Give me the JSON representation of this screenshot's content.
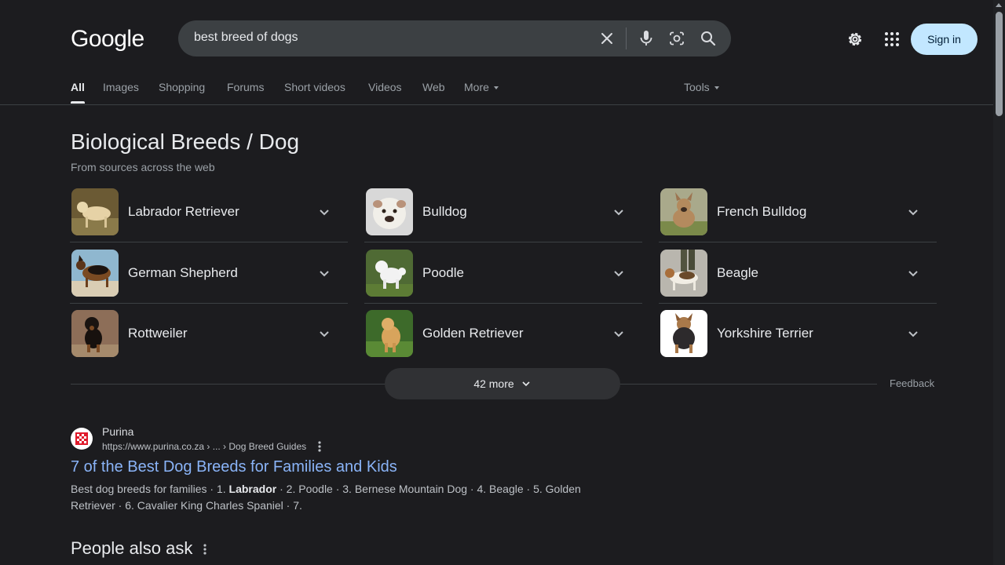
{
  "header": {
    "logo": "Google",
    "query": "best breed of dogs",
    "sign_in": "Sign in"
  },
  "tabs": [
    {
      "label": "All"
    },
    {
      "label": "Images"
    },
    {
      "label": "Shopping"
    },
    {
      "label": "Forums"
    },
    {
      "label": "Short videos"
    },
    {
      "label": "Videos"
    },
    {
      "label": "Web"
    },
    {
      "label": "More"
    }
  ],
  "tools_label": "Tools",
  "breeds_panel": {
    "title": "Biological Breeds / Dog",
    "subtitle": "From sources across the web",
    "items": [
      {
        "label": "Labrador Retriever"
      },
      {
        "label": "Bulldog"
      },
      {
        "label": "French Bulldog"
      },
      {
        "label": "German Shepherd"
      },
      {
        "label": "Poodle"
      },
      {
        "label": "Beagle"
      },
      {
        "label": "Rottweiler"
      },
      {
        "label": "Golden Retriever"
      },
      {
        "label": "Yorkshire Terrier"
      }
    ],
    "more_label": "42 more",
    "feedback": "Feedback"
  },
  "result": {
    "site_name": "Purina",
    "url": "https://www.purina.co.za › ... › Dog Breed Guides",
    "title": "7 of the Best Dog Breeds for Families and Kids",
    "snippet_before": "Best dog breeds for families · 1. ",
    "snippet_bold": "Labrador",
    "snippet_after": " · 2. Poodle · 3. Bernese Mountain Dog · 4. Beagle · 5. Golden Retriever · 6. Cavalier King Charles Spaniel · 7."
  },
  "people_also_ask": "People also ask"
}
